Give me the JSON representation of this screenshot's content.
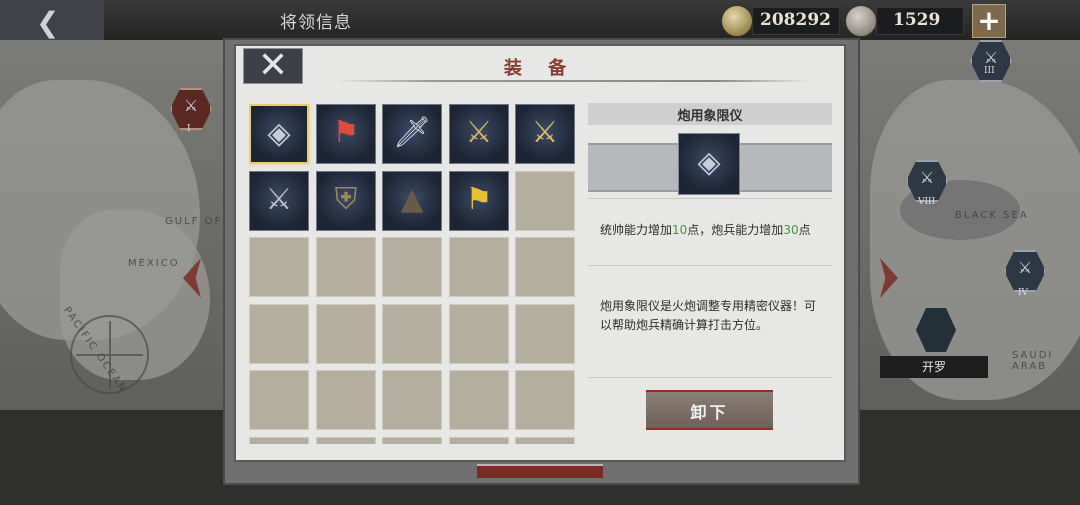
{
  "topbar": {
    "title": "将领信息",
    "gold": "208292",
    "silver": "1529",
    "plus_label": "+"
  },
  "map": {
    "labels": [
      "GULF OF",
      "MEXICO",
      "PACIFIC OCEAN",
      "SAUDI ARAB",
      "BLACK SEA"
    ],
    "city_label": "开罗",
    "markers": [
      "I",
      "III",
      "IV",
      "VIII"
    ]
  },
  "dialog": {
    "title": "装 备",
    "close_icon": "close-icon",
    "items": [
      {
        "name": "炮用象限仪",
        "icon": "quadrant-icon",
        "glyph": "◈",
        "color": "#c7ccd6",
        "selected": true
      },
      {
        "name": "flag",
        "icon": "flag-icon",
        "glyph": "⚑",
        "color": "#e04a3a",
        "selected": false
      },
      {
        "name": "dagger",
        "icon": "dagger-icon",
        "glyph": "🗡",
        "color": "#d5d9e0",
        "selected": false
      },
      {
        "name": "sword",
        "icon": "sword-icon",
        "glyph": "⚔",
        "color": "#d4b45a",
        "selected": false
      },
      {
        "name": "sword",
        "icon": "sword-icon",
        "glyph": "⚔",
        "color": "#d9bc63",
        "selected": false
      },
      {
        "name": "saber",
        "icon": "saber-icon",
        "glyph": "⚔",
        "color": "#b9bec8",
        "selected": false
      },
      {
        "name": "uniform",
        "icon": "uniform-icon",
        "glyph": "⛨",
        "color": "#9c8a55",
        "selected": false
      },
      {
        "name": "terrain",
        "icon": "terrain-icon",
        "glyph": "▲",
        "color": "#6b5a48",
        "selected": false
      },
      {
        "name": "banner",
        "icon": "banner-icon",
        "glyph": "⚑",
        "color": "#e8c12c",
        "selected": false
      }
    ]
  },
  "detail": {
    "item_name": "炮用象限仪",
    "stats_prefix": "统帅能力增加",
    "stat1_value": "10",
    "stats_mid": "点，炮兵能力增加",
    "stat2_value": "30",
    "stats_suffix": "点",
    "description": "炮用象限仪是火炮调整专用精密仪器！可以帮助炮兵精确计算打击方位。",
    "unequip_label": "卸下"
  },
  "colors": {
    "accent_red": "#8b3b2f",
    "stat_green": "#3f9a3c",
    "selected_border": "#e7cf66"
  }
}
